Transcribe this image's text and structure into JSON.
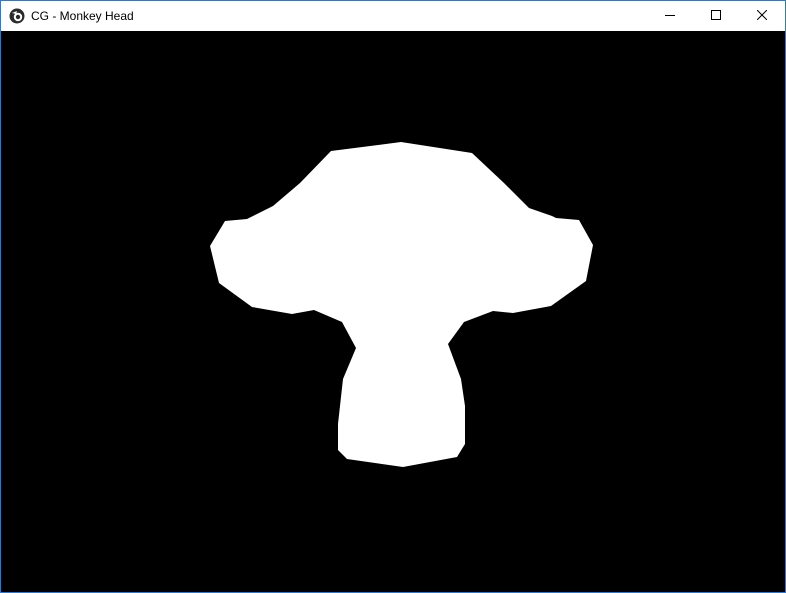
{
  "window": {
    "title": "CG - Monkey Head",
    "app_icon": "blender-logo-icon",
    "controls": {
      "minimize": "minimize-icon",
      "maximize": "maximize-icon",
      "close": "close-icon"
    }
  },
  "viewport": {
    "background_color": "#000000",
    "model": "monkey-head-silhouette",
    "model_color": "#ffffff"
  },
  "colors": {
    "window_border": "#2b79d6",
    "titlebar_bg": "#ffffff"
  }
}
